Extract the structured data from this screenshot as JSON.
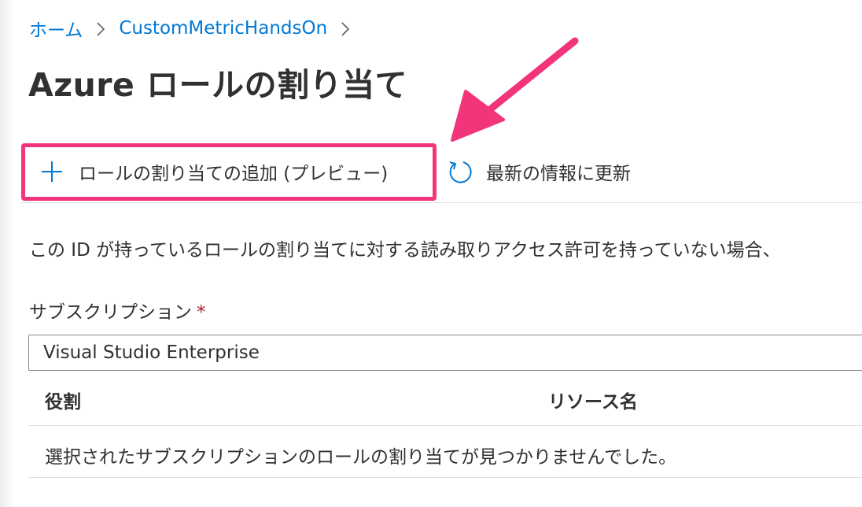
{
  "breadcrumb": {
    "items": [
      "ホーム",
      "CustomMetricHandsOn"
    ]
  },
  "page": {
    "title": "Azure ロールの割り当て"
  },
  "toolbar": {
    "add_label": "ロールの割り当ての追加 (プレビュー)",
    "add_icon": "plus-icon",
    "refresh_label": "最新の情報に更新",
    "refresh_icon": "refresh-icon"
  },
  "info": {
    "text": "この ID が持っているロールの割り当てに対する読み取りアクセス許可を持っていない場合、"
  },
  "subscription": {
    "label": "サブスクリプション",
    "required_marker": "*",
    "value": "Visual Studio Enterprise"
  },
  "table": {
    "columns": [
      "役割",
      "リソース名"
    ],
    "empty_message": "選択されたサブスクリプションのロールの割り当てが見つかりませんでした。"
  },
  "colors": {
    "link": "#0078d4",
    "highlight": "#f2347b",
    "required": "#a4262c",
    "text": "#323130"
  }
}
